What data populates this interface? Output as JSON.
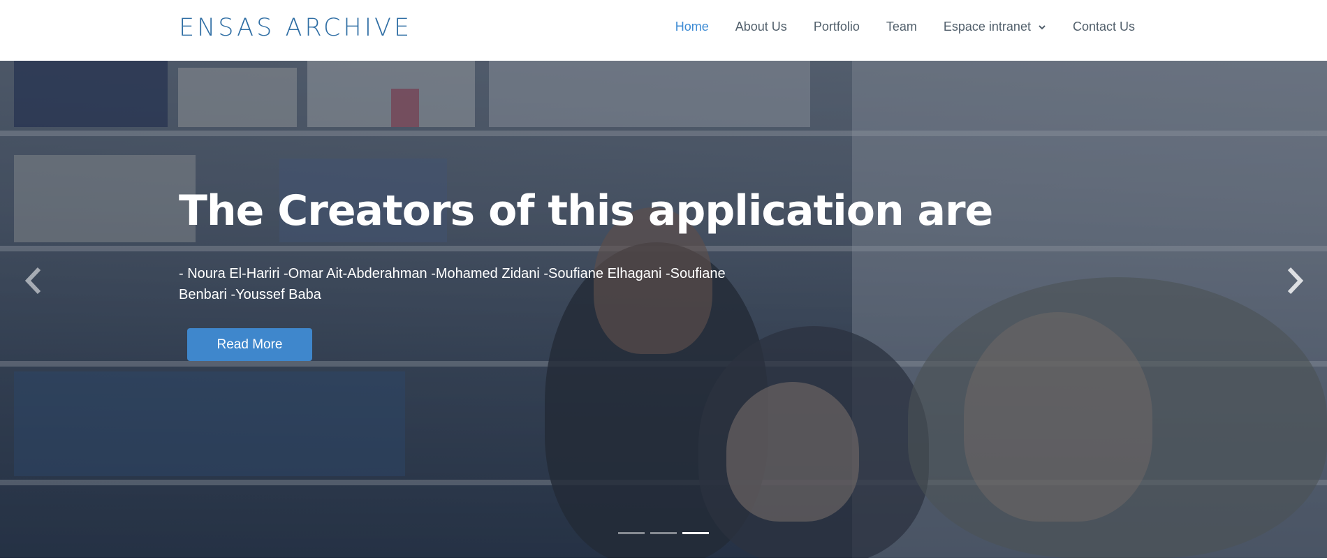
{
  "brand": {
    "name": "ENSAS ARCHIVE"
  },
  "nav": {
    "items": [
      {
        "label": "Home",
        "active": true
      },
      {
        "label": "About Us"
      },
      {
        "label": "Portfolio"
      },
      {
        "label": "Team"
      },
      {
        "label": "Espace intranet",
        "icon": "chevron-down-icon"
      },
      {
        "label": "Contact Us"
      }
    ]
  },
  "hero": {
    "title": "The Creators of this application are",
    "description": "- Noura El-Hariri -Omar Ait-Abderahman -Mohamed Zidani -Soufiane Elhagani -Soufiane Benbari -Youssef Baba",
    "button_label": "Read More",
    "prev_icon": "chevron-left-icon",
    "next_icon": "chevron-right-icon",
    "slides": {
      "count": 3,
      "active_index": 2
    }
  },
  "colors": {
    "brand": "#2f6ea4",
    "nav_text": "#52606c",
    "nav_active": "#3d8bd4",
    "button": "#3f87cc"
  }
}
